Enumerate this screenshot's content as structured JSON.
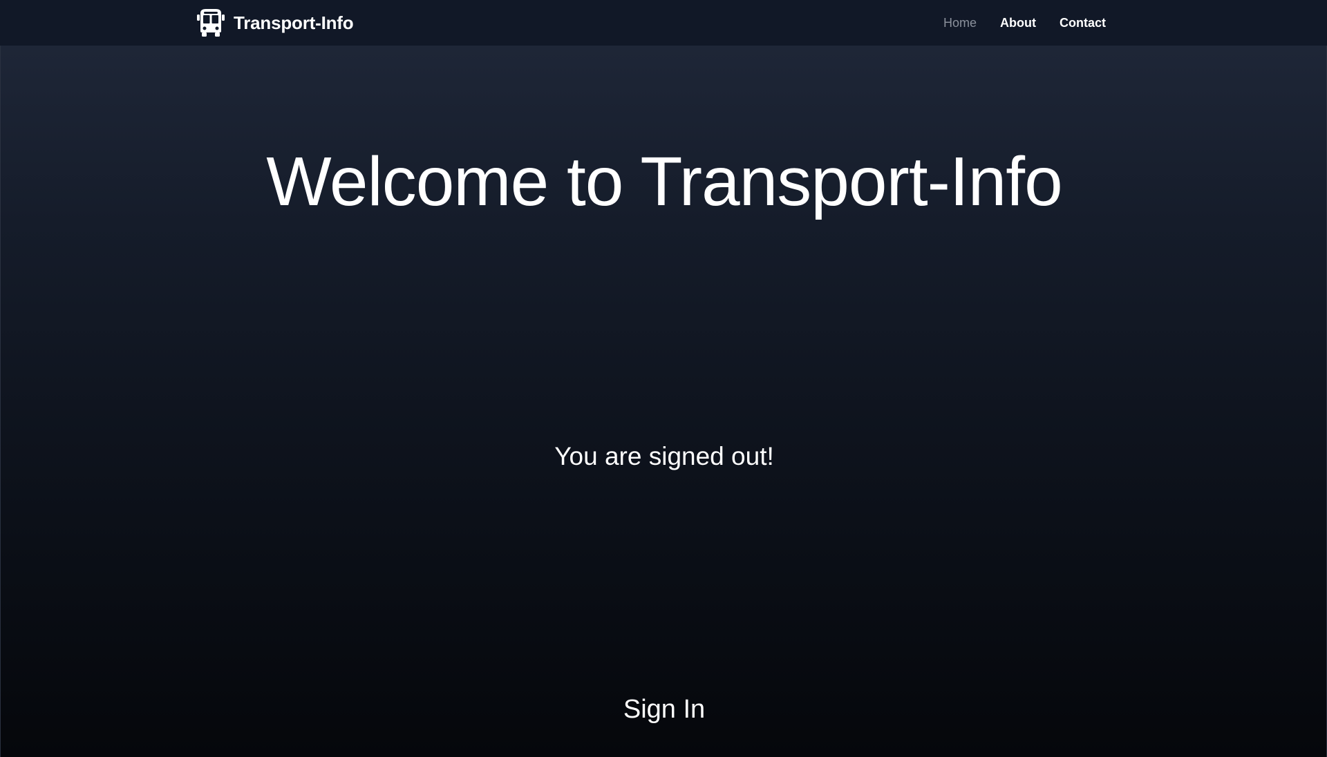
{
  "navbar": {
    "brand": {
      "name": "Transport-Info",
      "icon": "bus-icon"
    },
    "links": [
      {
        "label": "Home",
        "active": true
      },
      {
        "label": "About",
        "active": false
      },
      {
        "label": "Contact",
        "active": false
      }
    ]
  },
  "hero": {
    "title": "Welcome to Transport-Info",
    "status": "You are signed out!",
    "signin_label": "Sign In"
  },
  "colors": {
    "navbar_bg": "#111827",
    "active_link": "#8b919c",
    "text": "#ffffff"
  }
}
